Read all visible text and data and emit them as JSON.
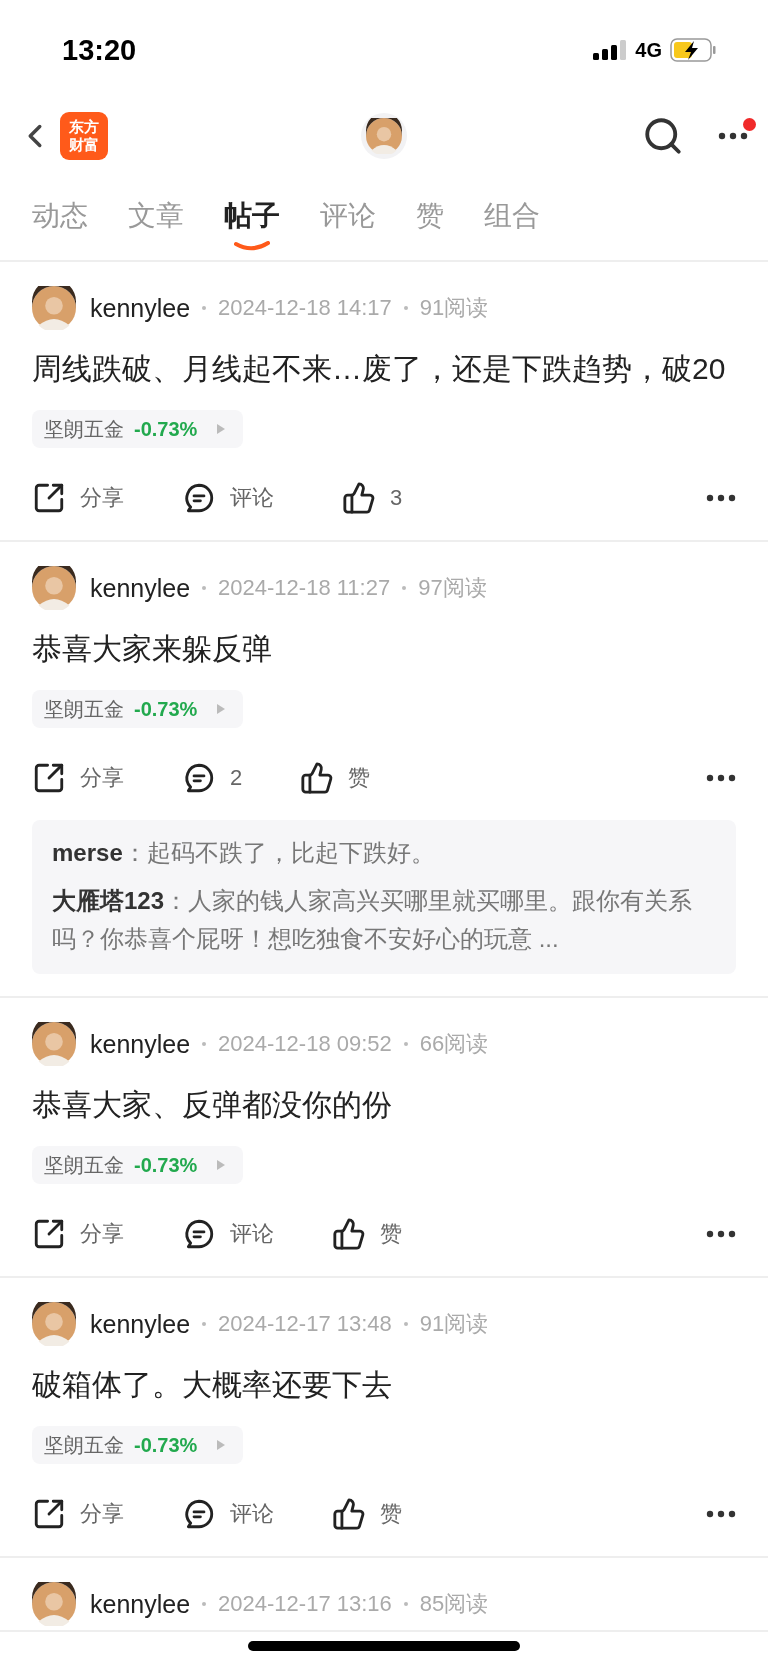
{
  "status_bar": {
    "time": "13:20",
    "network": "4G"
  },
  "nav": {
    "logo": [
      "东方",
      "财富"
    ],
    "notification_dot": true
  },
  "tabs": [
    {
      "label": "动态",
      "selected": false
    },
    {
      "label": "文章",
      "selected": false
    },
    {
      "label": "帖子",
      "selected": true
    },
    {
      "label": "评论",
      "selected": false
    },
    {
      "label": "赞",
      "selected": false
    },
    {
      "label": "组合",
      "selected": false
    }
  ],
  "posts": [
    {
      "author": "kennylee",
      "date": "2024-12-18 14:17",
      "reads": "91阅读",
      "text": "周线跌破、月线起不来…废了，还是下跌趋势，破20",
      "stock": {
        "name": "坚朗五金",
        "change": "-0.73%"
      },
      "actions": [
        {
          "kind": "share",
          "label": "分享"
        },
        {
          "kind": "comment",
          "label": "评论"
        },
        {
          "kind": "like",
          "label": "3"
        }
      ]
    },
    {
      "author": "kennylee",
      "date": "2024-12-18 11:27",
      "reads": "97阅读",
      "text": "恭喜大家来躲反弹",
      "stock": {
        "name": "坚朗五金",
        "change": "-0.73%"
      },
      "actions": [
        {
          "kind": "share",
          "label": "分享"
        },
        {
          "kind": "comment",
          "label": "2"
        },
        {
          "kind": "like",
          "label": "赞"
        }
      ],
      "comments": [
        {
          "text": "**merse**：起码不跌了，比起下跌好。"
        },
        {
          "text": "**大雁塔123**：人家的钱人家高兴买哪里就买哪里。跟你有关系吗？你恭喜个屁呀！想吃独食不安好心的玩意 ..."
        }
      ]
    },
    {
      "author": "kennylee",
      "date": "2024-12-18 09:52",
      "reads": "66阅读",
      "text": "恭喜大家、反弹都没你的份",
      "stock": {
        "name": "坚朗五金",
        "change": "-0.73%"
      },
      "actions": [
        {
          "kind": "share",
          "label": "分享"
        },
        {
          "kind": "comment",
          "label": "评论"
        },
        {
          "kind": "like",
          "label": "赞"
        }
      ]
    },
    {
      "author": "kennylee",
      "date": "2024-12-17 13:48",
      "reads": "91阅读",
      "text": "破箱体了。大概率还要下去",
      "stock": {
        "name": "坚朗五金",
        "change": "-0.73%"
      },
      "actions": [
        {
          "kind": "share",
          "label": "分享"
        },
        {
          "kind": "comment",
          "label": "评论"
        },
        {
          "kind": "like",
          "label": "赞"
        }
      ]
    },
    {
      "author": "kennylee",
      "date": "2024-12-17 13:16",
      "reads": "85阅读"
    }
  ]
}
